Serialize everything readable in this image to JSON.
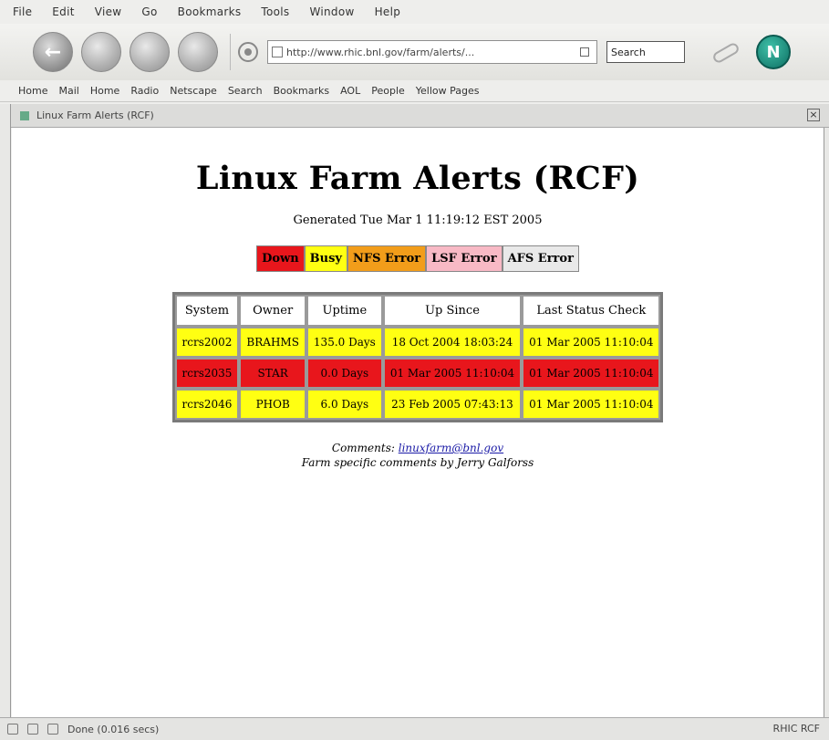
{
  "menubar": [
    "File",
    "Edit",
    "View",
    "Go",
    "Bookmarks",
    "Tools",
    "Window",
    "Help"
  ],
  "navbar": {
    "back_label": "←",
    "url": "http://www.rhic.bnl.gov/farm/alerts/...",
    "search_label": "Search"
  },
  "bookmarks": [
    "Home",
    "Mail",
    "Home",
    "Radio",
    "Netscape",
    "Search",
    "Bookmarks",
    "AOL",
    "People",
    "Yellow Pages"
  ],
  "tab": {
    "title": "Linux Farm Alerts (RCF)"
  },
  "page": {
    "title": "Linux Farm Alerts (RCF)",
    "generated": "Generated Tue Mar 1 11:19:12 EST 2005",
    "legend": [
      {
        "label": "Down",
        "color": "#e8161c"
      },
      {
        "label": "Busy",
        "color": "#ffff12"
      },
      {
        "label": "NFS Error",
        "color": "#f29d1a"
      },
      {
        "label": "LSF Error",
        "color": "#f8b9c5"
      },
      {
        "label": "AFS Error",
        "color": "#e9e9e9"
      }
    ],
    "table": {
      "headers": [
        "System",
        "Owner",
        "Uptime",
        "Up Since",
        "Last Status Check"
      ],
      "rows": [
        {
          "color": "#ffff12",
          "cells": [
            "rcrs2002",
            "BRAHMS",
            "135.0 Days",
            "18 Oct 2004 18:03:24",
            "01 Mar 2005 11:10:04"
          ]
        },
        {
          "color": "#e8161c",
          "cells": [
            "rcrs2035",
            "STAR",
            "0.0 Days",
            "01 Mar 2005 11:10:04",
            "01 Mar 2005 11:10:04"
          ]
        },
        {
          "color": "#ffff12",
          "cells": [
            "rcrs2046",
            "PHOB",
            "6.0 Days",
            "23 Feb 2005 07:43:13",
            "01 Mar 2005 11:10:04"
          ]
        }
      ]
    },
    "footer": {
      "comments_label": "Comments:",
      "email": "linuxfarm@bnl.gov",
      "line2": "Farm specific comments by Jerry Galforss"
    }
  },
  "statusbar": {
    "text": "Done (0.016 secs)",
    "right": "RHIC RCF"
  }
}
